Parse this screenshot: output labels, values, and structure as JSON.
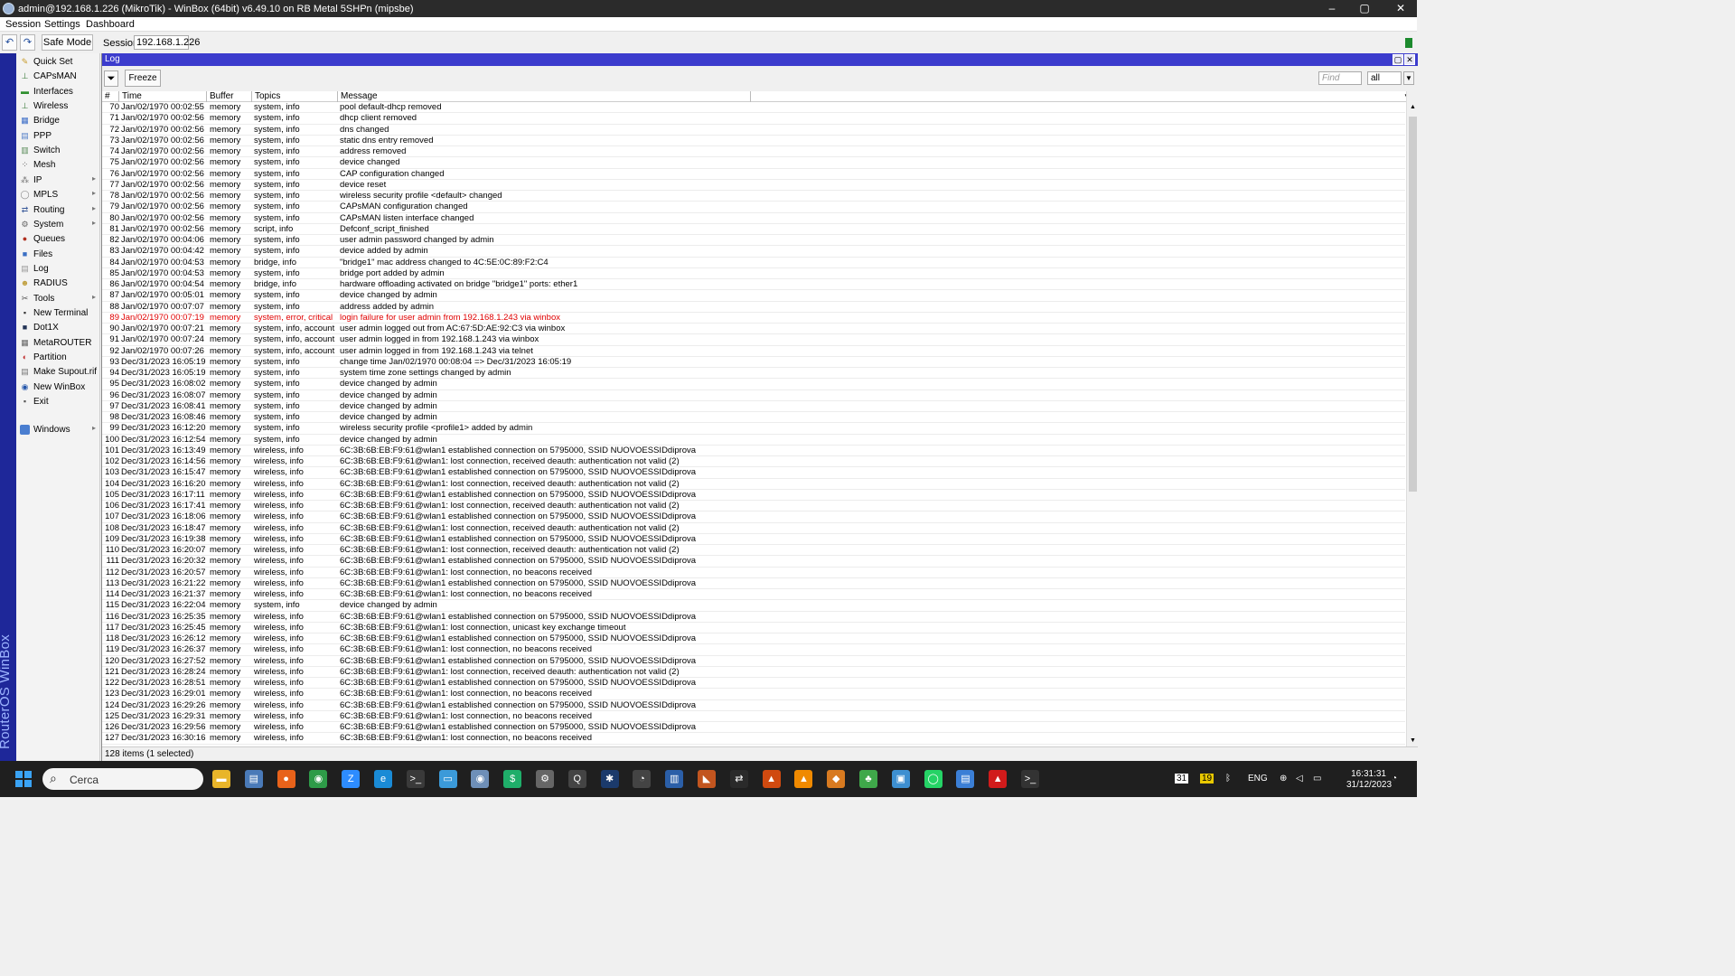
{
  "window": {
    "title": "admin@192.168.1.226 (MikroTik) - WinBox (64bit) v6.49.10 on RB Metal 5SHPn (mipsbe)",
    "minimize": "–",
    "maximize": "▢",
    "close": "✕"
  },
  "menu": {
    "session": "Session",
    "settings": "Settings",
    "dashboard": "Dashboard"
  },
  "toolbar": {
    "undo": "↶",
    "redo": "↷",
    "safe_mode": "Safe Mode",
    "session_label": "Session:",
    "session_value": "192.168.1.226"
  },
  "brand": "RouterOS WinBox",
  "sidebar": [
    {
      "label": "Quick Set",
      "icon": "quick-set-icon",
      "glyph": "✎",
      "color": "#c89b2a",
      "arrow": ""
    },
    {
      "label": "CAPsMAN",
      "icon": "capsman-icon",
      "glyph": "⊥",
      "color": "#3a7a3a",
      "arrow": ""
    },
    {
      "label": "Interfaces",
      "icon": "interfaces-icon",
      "glyph": "▬",
      "color": "#2f8f2f",
      "arrow": ""
    },
    {
      "label": "Wireless",
      "icon": "wireless-icon",
      "glyph": "⊥",
      "color": "#3a7a3a",
      "arrow": ""
    },
    {
      "label": "Bridge",
      "icon": "bridge-icon",
      "glyph": "▦",
      "color": "#3c6ec8",
      "arrow": ""
    },
    {
      "label": "PPP",
      "icon": "ppp-icon",
      "glyph": "▤",
      "color": "#5580c8",
      "arrow": ""
    },
    {
      "label": "Switch",
      "icon": "switch-icon",
      "glyph": "▥",
      "color": "#5a8c5a",
      "arrow": ""
    },
    {
      "label": "Mesh",
      "icon": "mesh-icon",
      "glyph": "⁘",
      "color": "#555555",
      "arrow": ""
    },
    {
      "label": "IP",
      "icon": "ip-icon",
      "glyph": "⁂",
      "color": "#777777",
      "arrow": "▸"
    },
    {
      "label": "MPLS",
      "icon": "mpls-icon",
      "glyph": "◯",
      "color": "#888888",
      "arrow": "▸"
    },
    {
      "label": "Routing",
      "icon": "routing-icon",
      "glyph": "⇄",
      "color": "#3a5a9a",
      "arrow": "▸"
    },
    {
      "label": "System",
      "icon": "system-icon",
      "glyph": "⚙",
      "color": "#666666",
      "arrow": "▸"
    },
    {
      "label": "Queues",
      "icon": "queues-icon",
      "glyph": "●",
      "color": "#b03020",
      "arrow": ""
    },
    {
      "label": "Files",
      "icon": "files-icon",
      "glyph": "■",
      "color": "#3a6fc4",
      "arrow": ""
    },
    {
      "label": "Log",
      "icon": "log-icon",
      "glyph": "▤",
      "color": "#999999",
      "arrow": ""
    },
    {
      "label": "RADIUS",
      "icon": "radius-icon",
      "glyph": "☻",
      "color": "#c0a040",
      "arrow": ""
    },
    {
      "label": "Tools",
      "icon": "tools-icon",
      "glyph": "✂",
      "color": "#555555",
      "arrow": "▸"
    },
    {
      "label": "New Terminal",
      "icon": "terminal-icon",
      "glyph": "▪",
      "color": "#333333",
      "arrow": ""
    },
    {
      "label": "Dot1X",
      "icon": "dot1x-icon",
      "glyph": "■",
      "color": "#223355",
      "arrow": ""
    },
    {
      "label": "MetaROUTER",
      "icon": "metarouter-icon",
      "glyph": "▦",
      "color": "#666666",
      "arrow": ""
    },
    {
      "label": "Partition",
      "icon": "partition-icon",
      "glyph": "◐",
      "color": "#c03030",
      "arrow": ""
    },
    {
      "label": "Make Supout.rif",
      "icon": "supout-icon",
      "glyph": "▤",
      "color": "#777777",
      "arrow": ""
    },
    {
      "label": "New WinBox",
      "icon": "winbox-icon",
      "glyph": "◉",
      "color": "#2255aa",
      "arrow": ""
    },
    {
      "label": "Exit",
      "icon": "exit-icon",
      "glyph": "▪",
      "color": "#555555",
      "arrow": ""
    }
  ],
  "sidebar_windows": {
    "label": "Windows",
    "arrow": "▸"
  },
  "log": {
    "title": "Log",
    "freeze": "Freeze",
    "find_placeholder": "Find",
    "filter_value": "all",
    "columns": {
      "num": "#",
      "time": "Time",
      "buffer": "Buffer",
      "topics": "Topics",
      "message": "Message"
    },
    "status": "128 items (1 selected)",
    "rows": [
      [
        "70",
        "Jan/02/1970 00:02:55",
        "memory",
        "system, info",
        "pool default-dhcp removed"
      ],
      [
        "71",
        "Jan/02/1970 00:02:56",
        "memory",
        "system, info",
        "dhcp client removed"
      ],
      [
        "72",
        "Jan/02/1970 00:02:56",
        "memory",
        "system, info",
        "dns changed"
      ],
      [
        "73",
        "Jan/02/1970 00:02:56",
        "memory",
        "system, info",
        "static dns entry removed"
      ],
      [
        "74",
        "Jan/02/1970 00:02:56",
        "memory",
        "system, info",
        "address removed"
      ],
      [
        "75",
        "Jan/02/1970 00:02:56",
        "memory",
        "system, info",
        "device changed"
      ],
      [
        "76",
        "Jan/02/1970 00:02:56",
        "memory",
        "system, info",
        "CAP configuration changed"
      ],
      [
        "77",
        "Jan/02/1970 00:02:56",
        "memory",
        "system, info",
        "device reset"
      ],
      [
        "78",
        "Jan/02/1970 00:02:56",
        "memory",
        "system, info",
        "wireless security profile <default> changed"
      ],
      [
        "79",
        "Jan/02/1970 00:02:56",
        "memory",
        "system, info",
        "CAPsMAN configuration changed"
      ],
      [
        "80",
        "Jan/02/1970 00:02:56",
        "memory",
        "system, info",
        "CAPsMAN listen interface changed"
      ],
      [
        "81",
        "Jan/02/1970 00:02:56",
        "memory",
        "script, info",
        "Defconf_script_finished"
      ],
      [
        "82",
        "Jan/02/1970 00:04:06",
        "memory",
        "system, info",
        "user admin password changed by admin"
      ],
      [
        "83",
        "Jan/02/1970 00:04:42",
        "memory",
        "system, info",
        "device added by admin"
      ],
      [
        "84",
        "Jan/02/1970 00:04:53",
        "memory",
        "bridge, info",
        "\"bridge1\" mac address changed to 4C:5E:0C:89:F2:C4"
      ],
      [
        "85",
        "Jan/02/1970 00:04:53",
        "memory",
        "system, info",
        "bridge port added by admin"
      ],
      [
        "86",
        "Jan/02/1970 00:04:54",
        "memory",
        "bridge, info",
        "hardware offloading activated on bridge \"bridge1\" ports: ether1"
      ],
      [
        "87",
        "Jan/02/1970 00:05:01",
        "memory",
        "system, info",
        "device changed by admin"
      ],
      [
        "88",
        "Jan/02/1970 00:07:07",
        "memory",
        "system, info",
        "address added by admin"
      ],
      [
        "89",
        "Jan/02/1970 00:07:19",
        "memory",
        "system, error, critical",
        "login failure for user admin from 192.168.1.243 via winbox"
      ],
      [
        "90",
        "Jan/02/1970 00:07:21",
        "memory",
        "system, info, account",
        "user admin logged out from AC:67:5D:AE:92:C3 via winbox"
      ],
      [
        "91",
        "Jan/02/1970 00:07:24",
        "memory",
        "system, info, account",
        "user admin logged in from 192.168.1.243 via winbox"
      ],
      [
        "92",
        "Jan/02/1970 00:07:26",
        "memory",
        "system, info, account",
        "user admin logged in from 192.168.1.243 via telnet"
      ],
      [
        "93",
        "Dec/31/2023 16:05:19",
        "memory",
        "system, info",
        "change time Jan/02/1970 00:08:04 => Dec/31/2023 16:05:19"
      ],
      [
        "94",
        "Dec/31/2023 16:05:19",
        "memory",
        "system, info",
        "system time zone settings changed by admin"
      ],
      [
        "95",
        "Dec/31/2023 16:08:02",
        "memory",
        "system, info",
        "device changed by admin"
      ],
      [
        "96",
        "Dec/31/2023 16:08:07",
        "memory",
        "system, info",
        "device changed by admin"
      ],
      [
        "97",
        "Dec/31/2023 16:08:41",
        "memory",
        "system, info",
        "device changed by admin"
      ],
      [
        "98",
        "Dec/31/2023 16:08:46",
        "memory",
        "system, info",
        "device changed by admin"
      ],
      [
        "99",
        "Dec/31/2023 16:12:20",
        "memory",
        "system, info",
        "wireless security profile <profile1> added by admin"
      ],
      [
        "100",
        "Dec/31/2023 16:12:54",
        "memory",
        "system, info",
        "device changed by admin"
      ],
      [
        "101",
        "Dec/31/2023 16:13:49",
        "memory",
        "wireless, info",
        "6C:3B:6B:EB:F9:61@wlan1 established connection on 5795000, SSID NUOVOESSIDdiprova"
      ],
      [
        "102",
        "Dec/31/2023 16:14:56",
        "memory",
        "wireless, info",
        "6C:3B:6B:EB:F9:61@wlan1: lost connection, received deauth: authentication not valid (2)"
      ],
      [
        "103",
        "Dec/31/2023 16:15:47",
        "memory",
        "wireless, info",
        "6C:3B:6B:EB:F9:61@wlan1 established connection on 5795000, SSID NUOVOESSIDdiprova"
      ],
      [
        "104",
        "Dec/31/2023 16:16:20",
        "memory",
        "wireless, info",
        "6C:3B:6B:EB:F9:61@wlan1: lost connection, received deauth: authentication not valid (2)"
      ],
      [
        "105",
        "Dec/31/2023 16:17:11",
        "memory",
        "wireless, info",
        "6C:3B:6B:EB:F9:61@wlan1 established connection on 5795000, SSID NUOVOESSIDdiprova"
      ],
      [
        "106",
        "Dec/31/2023 16:17:41",
        "memory",
        "wireless, info",
        "6C:3B:6B:EB:F9:61@wlan1: lost connection, received deauth: authentication not valid (2)"
      ],
      [
        "107",
        "Dec/31/2023 16:18:06",
        "memory",
        "wireless, info",
        "6C:3B:6B:EB:F9:61@wlan1 established connection on 5795000, SSID NUOVOESSIDdiprova"
      ],
      [
        "108",
        "Dec/31/2023 16:18:47",
        "memory",
        "wireless, info",
        "6C:3B:6B:EB:F9:61@wlan1: lost connection, received deauth: authentication not valid (2)"
      ],
      [
        "109",
        "Dec/31/2023 16:19:38",
        "memory",
        "wireless, info",
        "6C:3B:6B:EB:F9:61@wlan1 established connection on 5795000, SSID NUOVOESSIDdiprova"
      ],
      [
        "110",
        "Dec/31/2023 16:20:07",
        "memory",
        "wireless, info",
        "6C:3B:6B:EB:F9:61@wlan1: lost connection, received deauth: authentication not valid (2)"
      ],
      [
        "111",
        "Dec/31/2023 16:20:32",
        "memory",
        "wireless, info",
        "6C:3B:6B:EB:F9:61@wlan1 established connection on 5795000, SSID NUOVOESSIDdiprova"
      ],
      [
        "112",
        "Dec/31/2023 16:20:57",
        "memory",
        "wireless, info",
        "6C:3B:6B:EB:F9:61@wlan1: lost connection, no beacons received"
      ],
      [
        "113",
        "Dec/31/2023 16:21:22",
        "memory",
        "wireless, info",
        "6C:3B:6B:EB:F9:61@wlan1 established connection on 5795000, SSID NUOVOESSIDdiprova"
      ],
      [
        "114",
        "Dec/31/2023 16:21:37",
        "memory",
        "wireless, info",
        "6C:3B:6B:EB:F9:61@wlan1: lost connection, no beacons received"
      ],
      [
        "115",
        "Dec/31/2023 16:22:04",
        "memory",
        "system, info",
        "device changed by admin"
      ],
      [
        "116",
        "Dec/31/2023 16:25:35",
        "memory",
        "wireless, info",
        "6C:3B:6B:EB:F9:61@wlan1 established connection on 5795000, SSID NUOVOESSIDdiprova"
      ],
      [
        "117",
        "Dec/31/2023 16:25:45",
        "memory",
        "wireless, info",
        "6C:3B:6B:EB:F9:61@wlan1: lost connection, unicast key exchange timeout"
      ],
      [
        "118",
        "Dec/31/2023 16:26:12",
        "memory",
        "wireless, info",
        "6C:3B:6B:EB:F9:61@wlan1 established connection on 5795000, SSID NUOVOESSIDdiprova"
      ],
      [
        "119",
        "Dec/31/2023 16:26:37",
        "memory",
        "wireless, info",
        "6C:3B:6B:EB:F9:61@wlan1: lost connection, no beacons received"
      ],
      [
        "120",
        "Dec/31/2023 16:27:52",
        "memory",
        "wireless, info",
        "6C:3B:6B:EB:F9:61@wlan1 established connection on 5795000, SSID NUOVOESSIDdiprova"
      ],
      [
        "121",
        "Dec/31/2023 16:28:24",
        "memory",
        "wireless, info",
        "6C:3B:6B:EB:F9:61@wlan1: lost connection, received deauth: authentication not valid (2)"
      ],
      [
        "122",
        "Dec/31/2023 16:28:51",
        "memory",
        "wireless, info",
        "6C:3B:6B:EB:F9:61@wlan1 established connection on 5795000, SSID NUOVOESSIDdiprova"
      ],
      [
        "123",
        "Dec/31/2023 16:29:01",
        "memory",
        "wireless, info",
        "6C:3B:6B:EB:F9:61@wlan1: lost connection, no beacons received"
      ],
      [
        "124",
        "Dec/31/2023 16:29:26",
        "memory",
        "wireless, info",
        "6C:3B:6B:EB:F9:61@wlan1 established connection on 5795000, SSID NUOVOESSIDdiprova"
      ],
      [
        "125",
        "Dec/31/2023 16:29:31",
        "memory",
        "wireless, info",
        "6C:3B:6B:EB:F9:61@wlan1: lost connection, no beacons received"
      ],
      [
        "126",
        "Dec/31/2023 16:29:56",
        "memory",
        "wireless, info",
        "6C:3B:6B:EB:F9:61@wlan1 established connection on 5795000, SSID NUOVOESSIDdiprova"
      ],
      [
        "127",
        "Dec/31/2023 16:30:16",
        "memory",
        "wireless, info",
        "6C:3B:6B:EB:F9:61@wlan1: lost connection, no beacons received"
      ]
    ]
  },
  "taskbar": {
    "search_placeholder": "Cerca",
    "apps": [
      {
        "name": "file-explorer-icon",
        "glyph": "▬",
        "color": "#e8b52a"
      },
      {
        "name": "task-app-icon",
        "glyph": "▤",
        "color": "#4a7ab8"
      },
      {
        "name": "firefox-icon",
        "glyph": "●",
        "color": "#e8621a"
      },
      {
        "name": "chrome-icon",
        "glyph": "◉",
        "color": "#2e9b48"
      },
      {
        "name": "zoom-icon",
        "glyph": "Z",
        "color": "#2d8cff"
      },
      {
        "name": "edge-icon",
        "glyph": "e",
        "color": "#1a8bd6"
      },
      {
        "name": "terminal-app-icon",
        "glyph": ">_",
        "color": "#3a3a3a"
      },
      {
        "name": "store-icon",
        "glyph": "▭",
        "color": "#3b9ad9"
      },
      {
        "name": "winbox-app-icon",
        "glyph": "◉",
        "color": "#6e8fb8"
      },
      {
        "name": "dollar-app-icon",
        "glyph": "$",
        "color": "#1fae6a"
      },
      {
        "name": "settings-icon",
        "glyph": "⚙",
        "color": "#666666"
      },
      {
        "name": "search-tool-icon",
        "glyph": "Q",
        "color": "#444444"
      },
      {
        "name": "app-icon",
        "glyph": "✱",
        "color": "#1b3a6b"
      },
      {
        "name": "speed-icon",
        "glyph": "◔",
        "color": "#444444"
      },
      {
        "name": "monitor-icon",
        "glyph": "▥",
        "color": "#2b5fa8"
      },
      {
        "name": "media-icon",
        "glyph": "◣",
        "color": "#c2551f"
      },
      {
        "name": "remote-icon",
        "glyph": "⇄",
        "color": "#2a2a2a"
      },
      {
        "name": "photo-icon",
        "glyph": "▲",
        "color": "#d04a10"
      },
      {
        "name": "vlc-icon",
        "glyph": "▲",
        "color": "#f08a00"
      },
      {
        "name": "app2-icon",
        "glyph": "◆",
        "color": "#d87a20"
      },
      {
        "name": "leaf-app-icon",
        "glyph": "♣",
        "color": "#3fa84a"
      },
      {
        "name": "image-viewer-icon",
        "glyph": "▣",
        "color": "#3d8fd1"
      },
      {
        "name": "whatsapp-icon",
        "glyph": "◯",
        "color": "#25d366"
      },
      {
        "name": "notes-icon",
        "glyph": "▤",
        "color": "#3b7fd6"
      },
      {
        "name": "pdf-icon",
        "glyph": "▲",
        "color": "#d11b1b"
      },
      {
        "name": "console-icon",
        "glyph": ">_",
        "color": "#333333"
      }
    ],
    "tray_calendar": "31",
    "tray_num": "19",
    "language": "ENG",
    "time": "16:31:31",
    "date": "31/12/2023"
  }
}
